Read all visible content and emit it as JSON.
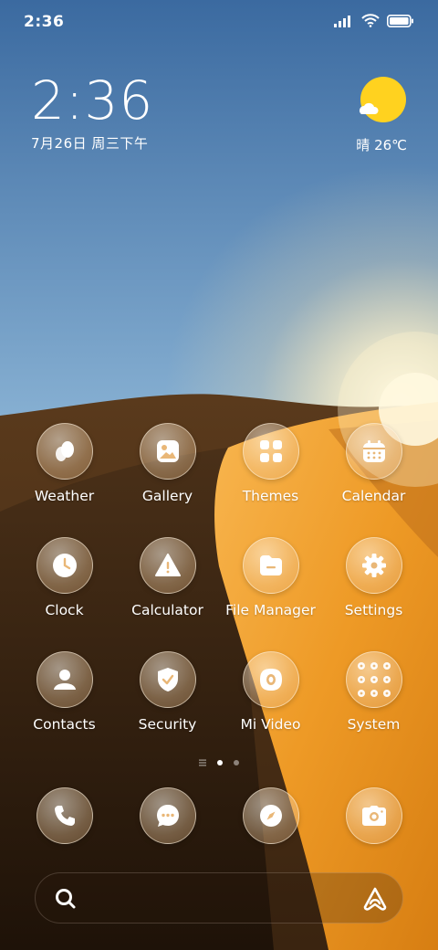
{
  "status_bar": {
    "time": "2:36",
    "icons": [
      "signal-icon",
      "wifi-icon",
      "battery-icon"
    ]
  },
  "clock_widget": {
    "time": "2:36",
    "date": "7月26日 周三下午"
  },
  "weather_widget": {
    "icon": "sunny-cloud-icon",
    "text": "晴 26℃"
  },
  "apps": [
    {
      "label": "Weather",
      "icon": "weather-icon"
    },
    {
      "label": "Gallery",
      "icon": "gallery-icon"
    },
    {
      "label": "Themes",
      "icon": "themes-icon"
    },
    {
      "label": "Calendar",
      "icon": "calendar-icon"
    },
    {
      "label": "Clock",
      "icon": "clock-icon"
    },
    {
      "label": "Calculator",
      "icon": "calculator-icon"
    },
    {
      "label": "File Manager",
      "icon": "file-manager-icon"
    },
    {
      "label": "Settings",
      "icon": "settings-icon"
    },
    {
      "label": "Contacts",
      "icon": "contacts-icon"
    },
    {
      "label": "Security",
      "icon": "security-icon"
    },
    {
      "label": "Mi Video",
      "icon": "mi-video-icon"
    },
    {
      "label": "System",
      "icon": "system-folder-icon"
    }
  ],
  "pager": {
    "pages": 2,
    "active": 0
  },
  "dock": [
    {
      "icon": "phone-icon"
    },
    {
      "icon": "messages-icon"
    },
    {
      "icon": "browser-icon"
    },
    {
      "icon": "camera-icon"
    }
  ],
  "search_bar": {
    "icons": [
      "search-icon",
      "assistant-icon"
    ]
  },
  "colors": {
    "sky_top": "#3f6fa3",
    "sky_bottom": "#e7e3d2",
    "sun": "#fff3c4",
    "dune": "#f0a030",
    "shadow": "#3a2410",
    "weather_sun": "#ffd21f",
    "icon_glyph": "#ffffff"
  }
}
